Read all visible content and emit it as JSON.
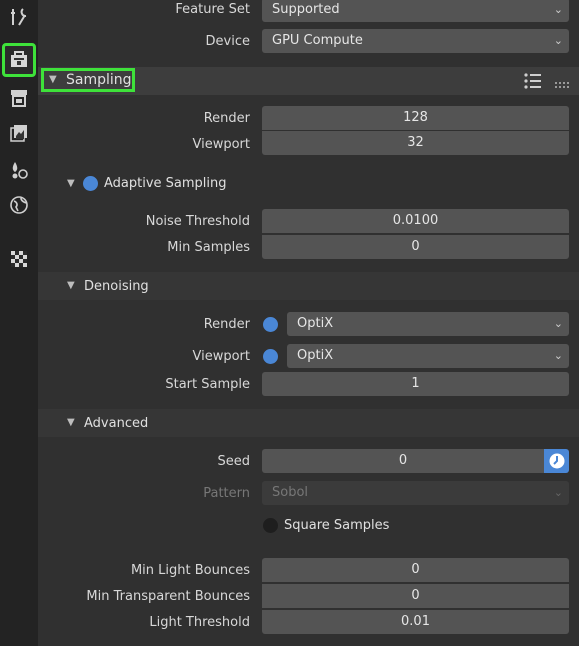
{
  "colors": {
    "accent": "#4a87d6",
    "highlight": "#3ee23a",
    "bg": "#303030",
    "field": "#545454"
  },
  "sidebar": {
    "tabs": [
      {
        "name": "tool-icon",
        "active": false
      },
      {
        "name": "render-icon",
        "active": true
      },
      {
        "name": "output-icon",
        "active": false
      },
      {
        "name": "view-layer-icon",
        "active": false
      },
      {
        "name": "scene-icon",
        "active": false
      },
      {
        "name": "world-icon",
        "active": false
      },
      {
        "name": "texture-icon",
        "active": false
      }
    ]
  },
  "top": {
    "feature_set_label": "Feature Set",
    "feature_set_value": "Supported",
    "device_label": "Device",
    "device_value": "GPU Compute"
  },
  "sampling": {
    "title": "Sampling",
    "render_label": "Render",
    "render_value": "128",
    "viewport_label": "Viewport",
    "viewport_value": "32"
  },
  "adaptive": {
    "title": "Adaptive Sampling",
    "enabled": true,
    "noise_label": "Noise Threshold",
    "noise_value": "0.0100",
    "min_samples_label": "Min Samples",
    "min_samples_value": "0"
  },
  "denoising": {
    "title": "Denoising",
    "render_label": "Render",
    "render_value": "OptiX",
    "viewport_label": "Viewport",
    "viewport_value": "OptiX",
    "start_label": "Start Sample",
    "start_value": "1"
  },
  "advanced": {
    "title": "Advanced",
    "seed_label": "Seed",
    "seed_value": "0",
    "pattern_label": "Pattern",
    "pattern_value": "Sobol",
    "square_label": "Square Samples",
    "min_light_label": "Min Light Bounces",
    "min_light_value": "0",
    "min_trans_label": "Min Transparent Bounces",
    "min_trans_value": "0",
    "light_thresh_label": "Light Threshold",
    "light_thresh_value": "0.01"
  }
}
